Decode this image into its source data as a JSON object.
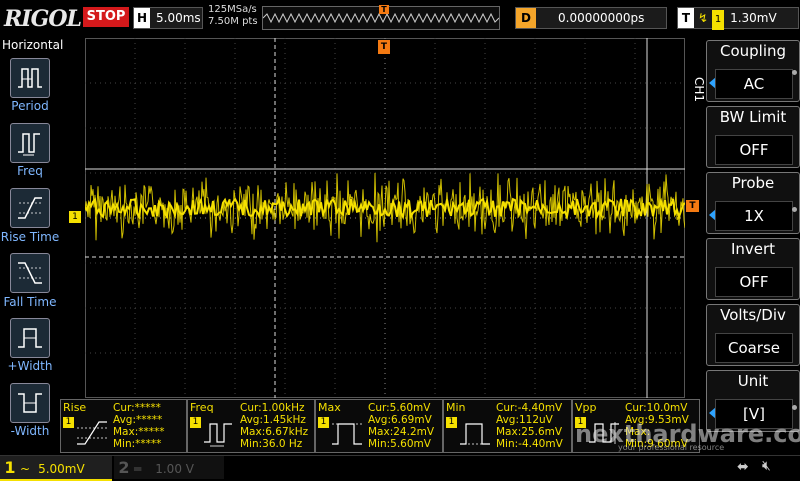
{
  "header": {
    "brand": "RIGOL",
    "run_state": "STOP",
    "timebase_key": "H",
    "timebase": "5.00ms",
    "sample_rate": "125MSa/s",
    "memory_depth": "7.50M pts",
    "trigger_marker": "T",
    "delay_key": "D",
    "delay": "0.00000000ps",
    "trigger_key": "T",
    "trigger_channel": "1",
    "trigger_level": "1.30mV"
  },
  "horizontal_menu": {
    "title": "Horizontal",
    "items": [
      {
        "label": "Period",
        "icon": "period-icon"
      },
      {
        "label": "Freq",
        "icon": "freq-icon"
      },
      {
        "label": "Rise Time",
        "icon": "rise-time-icon"
      },
      {
        "label": "Fall Time",
        "icon": "fall-time-icon"
      },
      {
        "label": "+Width",
        "icon": "positive-width-icon"
      },
      {
        "label": "-Width",
        "icon": "negative-width-icon"
      }
    ]
  },
  "channel_menu": {
    "tab": "CH1",
    "items": [
      {
        "title": "Coupling",
        "value": "AC"
      },
      {
        "title": "BW Limit",
        "value": "OFF"
      },
      {
        "title": "Probe",
        "value": "1X"
      },
      {
        "title": "Invert",
        "value": "OFF"
      },
      {
        "title": "Volts/Div",
        "value": "Coarse"
      },
      {
        "title": "Unit",
        "value": "[V]"
      }
    ]
  },
  "screen": {
    "ch1_marker": "1",
    "trigger_level_marker": "T",
    "trace_color": "#f5e000"
  },
  "measurements": [
    {
      "name": "Rise",
      "cur": "Cur:*****",
      "avg": "Avg:*****",
      "max": "Max:*****",
      "min": "Min:*****"
    },
    {
      "name": "Freq",
      "cur": "Cur:1.00kHz",
      "avg": "Avg:1.45kHz",
      "max": "Max:6.67kHz",
      "min": "Min:36.0 Hz"
    },
    {
      "name": "Max",
      "cur": "Cur:5.60mV",
      "avg": "Avg:6.69mV",
      "max": "Max:24.2mV",
      "min": "Min:5.60mV"
    },
    {
      "name": "Min",
      "cur": "Cur:-4.40mV",
      "avg": "Avg:112uV",
      "max": "Max:25.6mV",
      "min": "Min:-4.40mV"
    },
    {
      "name": "Vpp",
      "cur": "Cur:10.0mV",
      "avg": "Avg:9.53mV",
      "max": "Max:",
      "min": "Min:9.60mV"
    }
  ],
  "bottom_bar": {
    "ch1_num": "1",
    "ch1_coupling_icon": "~",
    "ch1_scale": "5.00mV",
    "ch2_num": "2",
    "ch2_scale": "1.00 V"
  },
  "watermark": {
    "text": "nexthardware.com",
    "subtext": "your professional resource"
  }
}
